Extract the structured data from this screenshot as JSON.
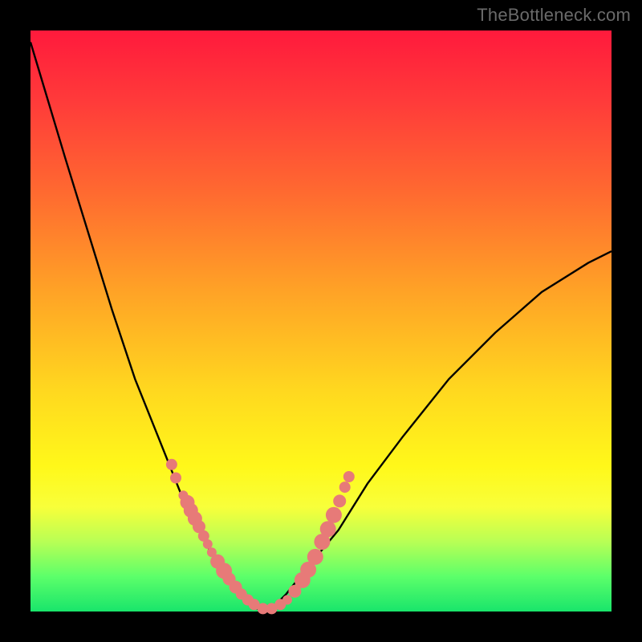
{
  "watermark": "TheBottleneck.com",
  "colors": {
    "frame_bg": "#000000",
    "curve_stroke": "#000000",
    "sample_fill": "#e77a78",
    "gradient_stops": [
      "#ff1a3c",
      "#ff3a3a",
      "#ff6a30",
      "#ffa326",
      "#ffd81f",
      "#fff81a",
      "#f8ff3a",
      "#b8ff55",
      "#5cff6a",
      "#19e56b"
    ]
  },
  "chart_data": {
    "type": "line",
    "title": "",
    "xlabel": "",
    "ylabel": "",
    "xlim": [
      0,
      1
    ],
    "ylim": [
      0,
      1
    ],
    "note": "Axes unlabeled; values are approximate curve coordinates in [0,1] plot space (bottom-left origin).",
    "series": [
      {
        "name": "bottleneck-curve",
        "x": [
          0.0,
          0.03,
          0.06,
          0.1,
          0.14,
          0.18,
          0.22,
          0.26,
          0.3,
          0.34,
          0.36,
          0.38,
          0.4,
          0.42,
          0.44,
          0.48,
          0.53,
          0.58,
          0.64,
          0.72,
          0.8,
          0.88,
          0.96,
          1.0
        ],
        "y": [
          0.98,
          0.88,
          0.78,
          0.65,
          0.52,
          0.4,
          0.3,
          0.2,
          0.12,
          0.05,
          0.03,
          0.01,
          0.0,
          0.01,
          0.03,
          0.08,
          0.14,
          0.22,
          0.3,
          0.4,
          0.48,
          0.55,
          0.6,
          0.62
        ]
      }
    ],
    "sample_points": {
      "name": "highlighted-segment",
      "x": [
        0.243,
        0.25,
        0.263,
        0.27,
        0.276,
        0.283,
        0.29,
        0.298,
        0.305,
        0.312,
        0.322,
        0.333,
        0.342,
        0.353,
        0.363,
        0.374,
        0.385,
        0.4,
        0.415,
        0.43,
        0.442,
        0.455,
        0.468,
        0.478,
        0.49,
        0.502,
        0.512,
        0.522,
        0.532,
        0.541,
        0.548
      ],
      "y": [
        0.253,
        0.23,
        0.2,
        0.188,
        0.174,
        0.16,
        0.146,
        0.13,
        0.116,
        0.102,
        0.086,
        0.07,
        0.056,
        0.042,
        0.03,
        0.02,
        0.012,
        0.005,
        0.005,
        0.012,
        0.02,
        0.035,
        0.054,
        0.072,
        0.094,
        0.12,
        0.142,
        0.166,
        0.19,
        0.214,
        0.232
      ],
      "r": [
        7,
        7,
        6,
        9,
        9,
        9,
        8,
        7,
        6,
        6,
        9,
        10,
        8,
        8,
        7,
        7,
        7,
        7,
        7,
        7,
        6,
        8,
        10,
        10,
        10,
        10,
        10,
        10,
        8,
        7,
        7
      ]
    }
  }
}
